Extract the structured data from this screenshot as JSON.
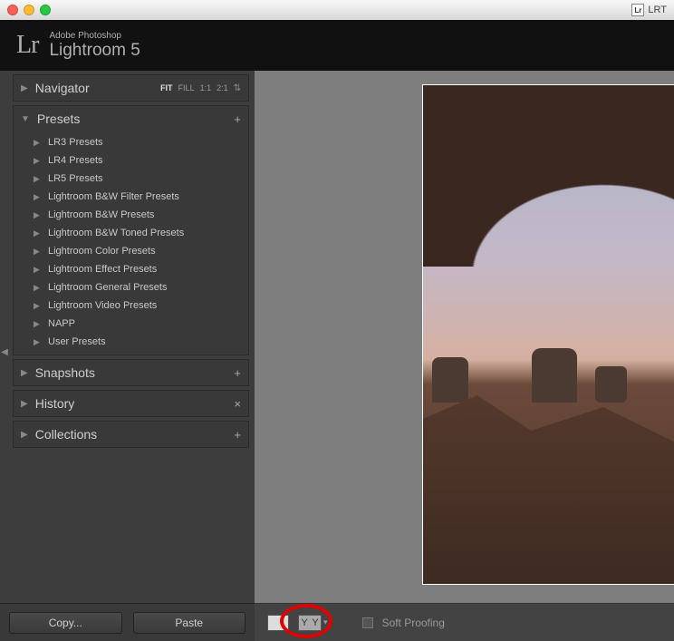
{
  "titlebar": {
    "right_label": "LRT"
  },
  "header": {
    "suite": "Adobe Photoshop",
    "product": "Lightroom 5",
    "logo": "Lr"
  },
  "navigator": {
    "label": "Navigator",
    "ratios": {
      "fit": "FIT",
      "fill": "FILL",
      "one": "1:1",
      "two": "2:1"
    }
  },
  "presets": {
    "label": "Presets",
    "items": [
      "LR3 Presets",
      "LR4 Presets",
      "LR5 Presets",
      "Lightroom B&W Filter Presets",
      "Lightroom B&W Presets",
      "Lightroom B&W Toned Presets",
      "Lightroom Color Presets",
      "Lightroom Effect Presets",
      "Lightroom General Presets",
      "Lightroom Video Presets",
      "NAPP",
      "User Presets"
    ]
  },
  "snapshots": {
    "label": "Snapshots"
  },
  "history": {
    "label": "History"
  },
  "collections": {
    "label": "Collections"
  },
  "buttons": {
    "copy": "Copy...",
    "paste": "Paste"
  },
  "toolbar": {
    "soft_proofing": "Soft Proofing",
    "y_label": "Y"
  }
}
